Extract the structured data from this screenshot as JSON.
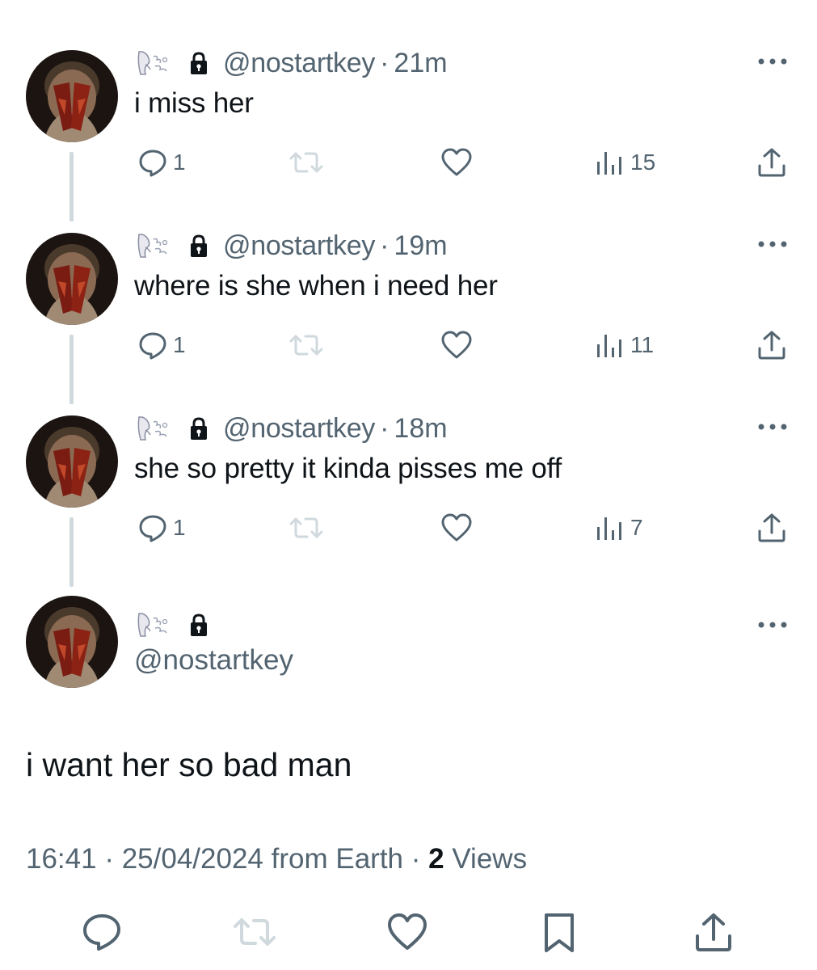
{
  "thread": [
    {
      "handle": "@nostartkey",
      "separator": "·",
      "time": "21m",
      "text": "i miss her",
      "replies": "1",
      "views": "15"
    },
    {
      "handle": "@nostartkey",
      "separator": "·",
      "time": "19m",
      "text": "where is she when i need her",
      "replies": "1",
      "views": "11"
    },
    {
      "handle": "@nostartkey",
      "separator": "·",
      "time": "18m",
      "text": "she so pretty it kinda pisses me off",
      "replies": "1",
      "views": "7"
    }
  ],
  "main_tweet": {
    "handle": "@nostartkey",
    "text": "i want her so bad man",
    "time": "16:41",
    "separator": "·",
    "date": "25/04/2024",
    "source": "from Earth",
    "views_count": "2",
    "views_label": "Views"
  },
  "icons": {
    "reply": "reply-icon",
    "retweet": "retweet-icon",
    "like": "heart-icon",
    "views": "views-chart-icon",
    "share": "share-icon",
    "bookmark": "bookmark-icon",
    "more": "more-options-icon",
    "lock": "lock-icon",
    "display_name": "display-name-emoji-icon"
  },
  "colors": {
    "text": "#0f1419",
    "secondary": "#536471",
    "retweet_disabled": "#cfd9de",
    "thread_line": "#cfd9de"
  }
}
